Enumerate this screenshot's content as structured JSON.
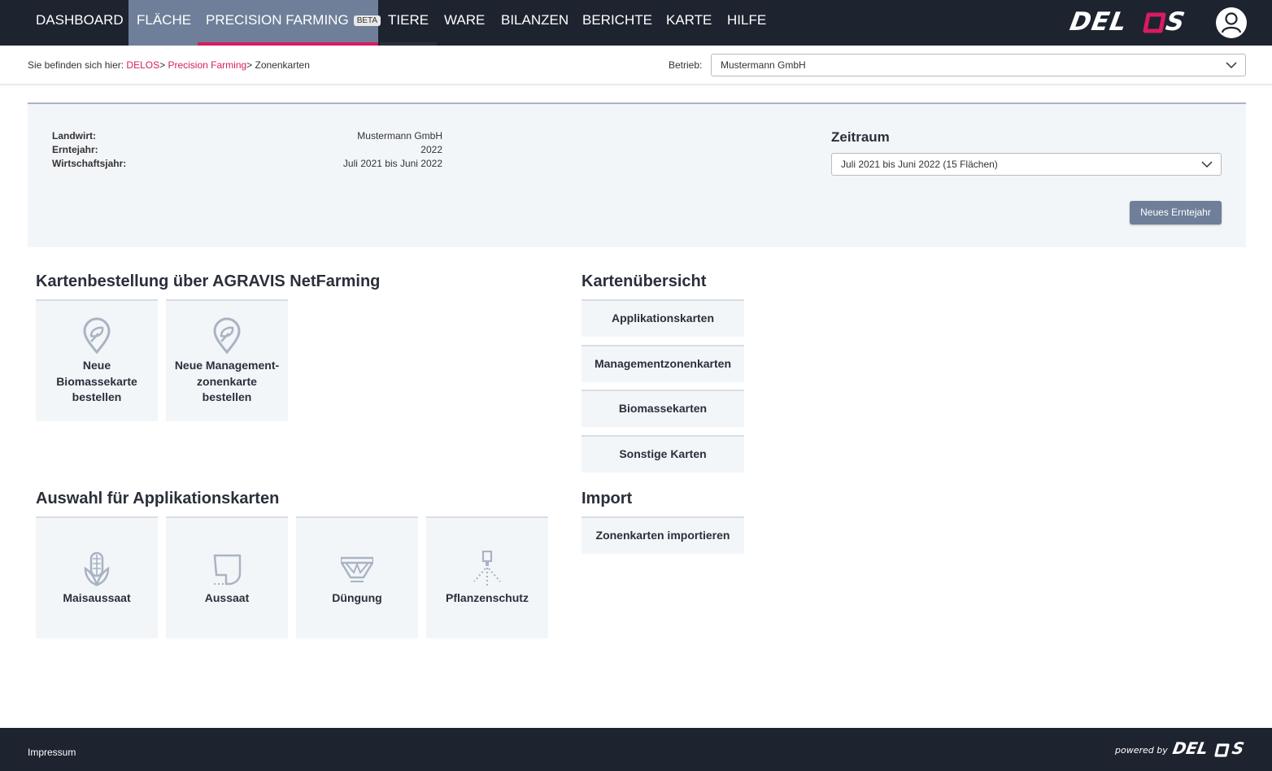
{
  "nav": {
    "items": [
      "DASHBOARD",
      "FLÄCHE",
      "PRECISION FARMING",
      "TIERE",
      "WARE",
      "BILANZEN",
      "BERICHTE",
      "KARTE",
      "HILFE"
    ],
    "beta": "BETA",
    "logo": "DELOS",
    "brand_accent": "#d81b60",
    "user_icon": "user-icon"
  },
  "breadcrumb": {
    "prefix": "Sie befinden sich hier:",
    "items": [
      "DELOS",
      "Precision Farming",
      "Zonenkarten"
    ],
    "sep": ">"
  },
  "betrieb": {
    "label": "Betrieb:",
    "value": "Mustermann GmbH"
  },
  "info": {
    "landwirt_label": "Landwirt:",
    "landwirt_value": "Mustermann GmbH",
    "erntejahr_label": "Erntejahr:",
    "erntejahr_value": "2022",
    "wirtschaftsjahr_label": "Wirtschaftsjahr:",
    "wirtschaftsjahr_value": "Juli 2021 bis Juni 2022"
  },
  "zeitraum": {
    "title": "Zeitraum",
    "value": "Juli 2021 bis Juni 2022 (15 Flächen)",
    "button": "Neues Erntejahr"
  },
  "bestellung": {
    "title": "Kartenbestellung über AGRAVIS NetFarming",
    "tiles": [
      {
        "lines": [
          "Neue",
          "Biomassekarte",
          "bestellen"
        ],
        "icon": "map-pin-icon"
      },
      {
        "lines": [
          "Neue Management-",
          "zonenkarte",
          "bestellen"
        ],
        "icon": "map-pin-icon"
      }
    ]
  },
  "uebersicht": {
    "title": "Kartenübersicht",
    "items": [
      "Applikationskarten",
      "Managementzonenkarten",
      "Biomassekarten",
      "Sonstige Karten"
    ]
  },
  "applikation": {
    "title": "Auswahl für Applikationskarten",
    "tiles": [
      {
        "label": "Maisaussaat",
        "icon": "corn-icon"
      },
      {
        "label": "Aussaat",
        "icon": "seed-hopper-icon"
      },
      {
        "label": "Düngung",
        "icon": "fertilizer-spreader-icon"
      },
      {
        "label": "Pflanzenschutz",
        "icon": "sprayer-icon"
      }
    ]
  },
  "import": {
    "title": "Import",
    "button": "Zonenkarten importieren"
  },
  "footer": {
    "impressum": "Impressum",
    "powered_by": "powered by",
    "logo": "DELOS"
  }
}
